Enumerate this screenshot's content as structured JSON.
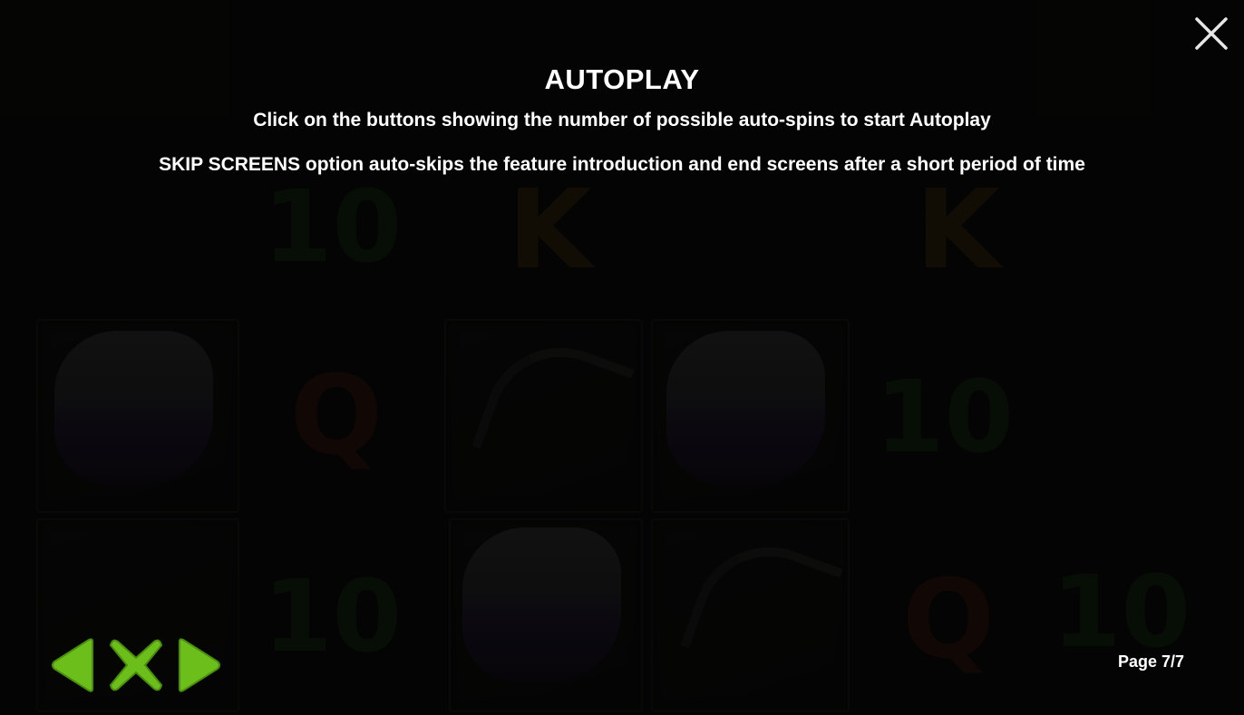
{
  "dialog": {
    "title": "AUTOPLAY",
    "lines": [
      "Click on the buttons showing the number of possible auto-spins to start Autoplay",
      "SKIP SCREENS option auto-skips the feature introduction and end screens after a short period of time"
    ]
  },
  "pagination": {
    "label": "Page 7/7",
    "current": 7,
    "total": 7
  },
  "controls": {
    "close_icon": "close-icon",
    "prev_icon": "arrow-left-icon",
    "exit_icon": "x-icon",
    "next_icon": "arrow-right-icon"
  },
  "background_symbols": [
    "10",
    "K",
    "K",
    "10",
    "Q",
    "10",
    "10",
    "Q"
  ],
  "colors": {
    "text": "#ffffff",
    "nav_green": "#6cbf1a",
    "nav_green_dark": "#4a8f0c",
    "close_icon": "#e6e6e6"
  }
}
